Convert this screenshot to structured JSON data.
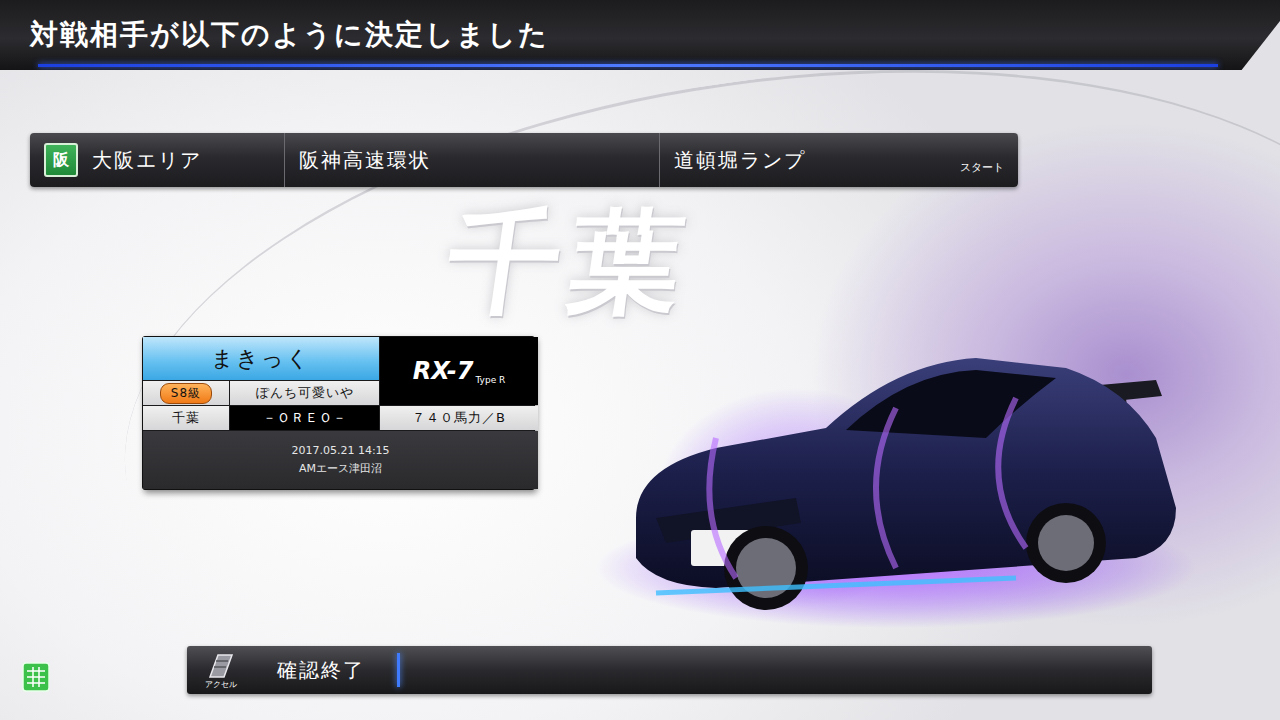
{
  "header": {
    "title": "対戦相手が以下のように決定しました"
  },
  "route": {
    "badge": "阪",
    "area": "大阪エリア",
    "course": "阪神高速環状",
    "ramp": "道頓堀ランプ",
    "start_label": "スタート"
  },
  "region_watermark": "千葉",
  "opponent": {
    "name": "まきっく",
    "car_model": "RX-7",
    "car_grade": "Type R",
    "rank": "S8級",
    "title": "ぽんち可愛いや",
    "region": "千葉",
    "team": "－ＯＲＥＯ－",
    "power": "７４０馬力／B",
    "date": "2017.05.21 14:15",
    "store": "AMエース津田沼"
  },
  "footer": {
    "pedal_label": "アクセル",
    "action": "確認終了"
  }
}
